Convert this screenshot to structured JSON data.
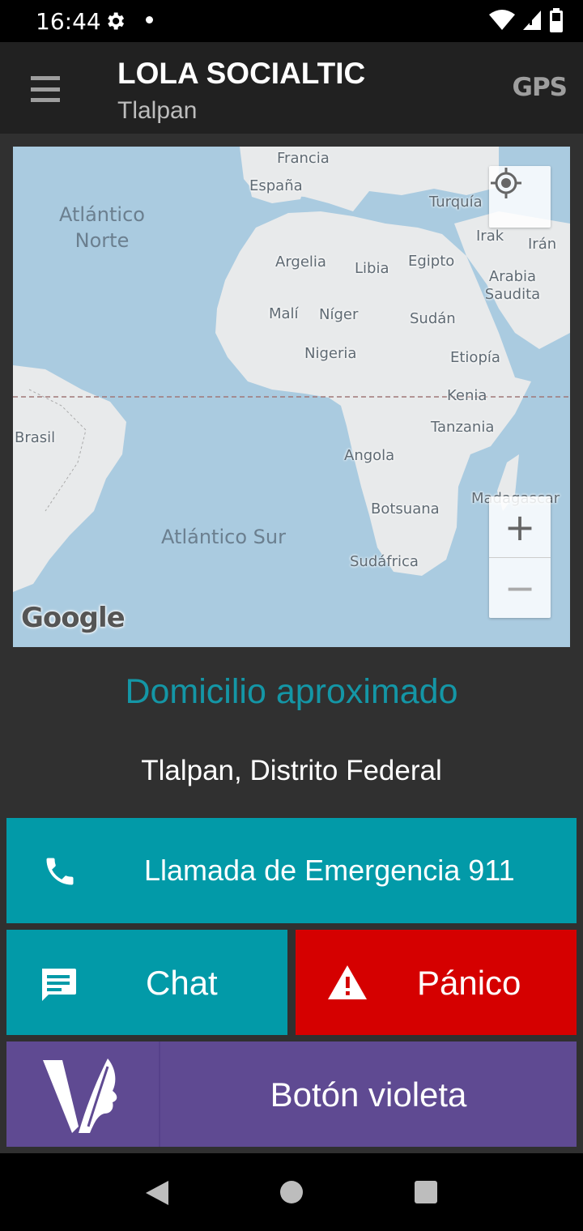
{
  "status_bar": {
    "time": "16:44"
  },
  "app_bar": {
    "title": "LOLA SOCIALTIC",
    "subtitle": "Tlalpan",
    "gps_label": "GPS"
  },
  "map": {
    "places": {
      "francia": "Francia",
      "espana": "España",
      "turquia": "Turquía",
      "irak": "Irak",
      "iran": "Irán",
      "argelia": "Argelia",
      "libia": "Libia",
      "egipto": "Egipto",
      "arabia": "Arabia Saudita",
      "mali": "Malí",
      "niger": "Níger",
      "sudan": "Sudán",
      "nigeria": "Nigeria",
      "etiopia": "Etiopía",
      "kenia": "Kenia",
      "tanzania": "Tanzania",
      "brasil": "Brasil",
      "angola": "Angola",
      "madagascar": "Madagascar",
      "botsuana": "Botsuana",
      "sudafrica": "Sudáfrica"
    },
    "ocean_north": "Atlántico Norte",
    "ocean_south": "Atlántico Sur",
    "google_logo": "Google",
    "zoom_in": "+",
    "zoom_out": "−"
  },
  "address": {
    "title": "Domicilio aproximado",
    "value": "Tlalpan, Distrito Federal"
  },
  "buttons": {
    "emergency": "Llamada de Emergencia 911",
    "chat": "Chat",
    "panic": "Pánico",
    "violet": "Botón violeta"
  },
  "colors": {
    "teal": "#029aa8",
    "red": "#d50000",
    "violet": "#5f4a92",
    "accent_text": "#1496a6"
  }
}
